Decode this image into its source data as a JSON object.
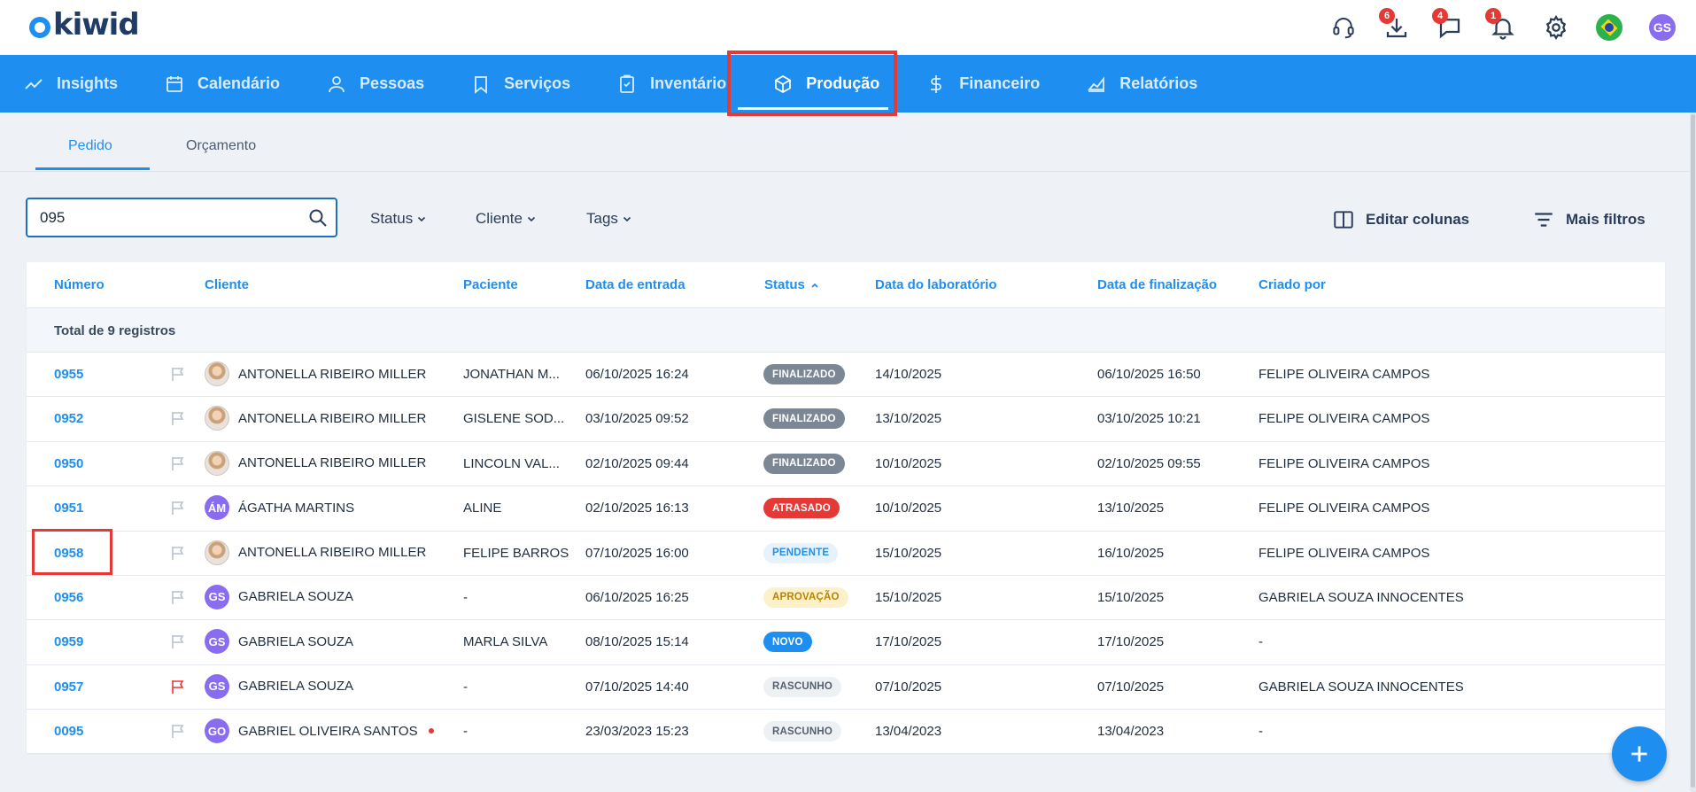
{
  "app": {
    "logo_text": "kiwid",
    "user_initials": "GS"
  },
  "topbar": {
    "download_badge": "6",
    "chat_badge": "4",
    "notifications_badge": "1"
  },
  "nav": {
    "items": [
      {
        "label": "Insights",
        "icon": "chart-line-icon"
      },
      {
        "label": "Calendário",
        "icon": "calendar-icon"
      },
      {
        "label": "Pessoas",
        "icon": "person-icon"
      },
      {
        "label": "Serviços",
        "icon": "bookmark-icon"
      },
      {
        "label": "Inventário",
        "icon": "clipboard-icon"
      },
      {
        "label": "Produção",
        "icon": "box-icon",
        "active": true
      },
      {
        "label": "Financeiro",
        "icon": "dollar-icon"
      },
      {
        "label": "Relatórios",
        "icon": "area-chart-icon"
      }
    ]
  },
  "subtabs": {
    "pedido": "Pedido",
    "orcamento": "Orçamento"
  },
  "filters": {
    "search_value": "095",
    "status": "Status",
    "cliente": "Cliente",
    "tags": "Tags",
    "edit_columns": "Editar colunas",
    "more_filters": "Mais filtros"
  },
  "table": {
    "headers": {
      "numero": "Número",
      "cliente": "Cliente",
      "paciente": "Paciente",
      "data_entrada": "Data de entrada",
      "status": "Status",
      "data_laboratorio": "Data do laboratório",
      "data_finalizacao": "Data de finalização",
      "criado_por": "Criado por"
    },
    "total_label": "Total de 9 registros",
    "rows": [
      {
        "numero": "0955",
        "flag": "grey",
        "avatar": "photo",
        "avatar_text": "",
        "cliente": "ANTONELLA RIBEIRO MILLER",
        "paciente": "JONATHAN M...",
        "data_entrada": "06/10/2025 16:24",
        "status": "FINALIZADO",
        "status_class": "s-finalizado",
        "data_laboratorio": "14/10/2025",
        "data_finalizacao": "06/10/2025 16:50",
        "criado_por": "FELIPE OLIVEIRA CAMPOS"
      },
      {
        "numero": "0952",
        "flag": "grey",
        "avatar": "photo",
        "avatar_text": "",
        "cliente": "ANTONELLA RIBEIRO MILLER",
        "paciente": "GISLENE SOD...",
        "data_entrada": "03/10/2025 09:52",
        "status": "FINALIZADO",
        "status_class": "s-finalizado",
        "data_laboratorio": "13/10/2025",
        "data_finalizacao": "03/10/2025 10:21",
        "criado_por": "FELIPE OLIVEIRA CAMPOS"
      },
      {
        "numero": "0950",
        "flag": "grey",
        "avatar": "photo",
        "avatar_text": "",
        "cliente": "ANTONELLA RIBEIRO MILLER",
        "paciente": "LINCOLN VAL...",
        "data_entrada": "02/10/2025 09:44",
        "status": "FINALIZADO",
        "status_class": "s-finalizado",
        "data_laboratorio": "10/10/2025",
        "data_finalizacao": "02/10/2025 09:55",
        "criado_por": "FELIPE OLIVEIRA CAMPOS"
      },
      {
        "numero": "0951",
        "flag": "grey",
        "avatar": "purple",
        "avatar_text": "ÁM",
        "cliente": "ÁGATHA MARTINS",
        "paciente": "ALINE",
        "data_entrada": "02/10/2025 16:13",
        "status": "ATRASADO",
        "status_class": "s-atrasado",
        "data_laboratorio": "10/10/2025",
        "data_finalizacao": "13/10/2025",
        "criado_por": "FELIPE OLIVEIRA CAMPOS"
      },
      {
        "numero": "0958",
        "flag": "grey",
        "avatar": "photo",
        "avatar_text": "",
        "cliente": "ANTONELLA RIBEIRO MILLER",
        "paciente": "FELIPE BARROS",
        "data_entrada": "07/10/2025 16:00",
        "status": "PENDENTE",
        "status_class": "s-pendente",
        "data_laboratorio": "15/10/2025",
        "data_finalizacao": "16/10/2025",
        "criado_por": "FELIPE OLIVEIRA CAMPOS"
      },
      {
        "numero": "0956",
        "flag": "grey",
        "avatar": "purple",
        "avatar_text": "GS",
        "cliente": "GABRIELA SOUZA",
        "paciente": "-",
        "data_entrada": "06/10/2025 16:25",
        "status": "APROVAÇÃO",
        "status_class": "s-aprovacao",
        "data_laboratorio": "15/10/2025",
        "data_finalizacao": "15/10/2025",
        "criado_por": "GABRIELA SOUZA INNOCENTES"
      },
      {
        "numero": "0959",
        "flag": "grey",
        "avatar": "purple",
        "avatar_text": "GS",
        "cliente": "GABRIELA SOUZA",
        "paciente": "MARLA SILVA",
        "data_entrada": "08/10/2025 15:14",
        "status": "NOVO",
        "status_class": "s-novo",
        "data_laboratorio": "17/10/2025",
        "data_finalizacao": "17/10/2025",
        "criado_por": "-"
      },
      {
        "numero": "0957",
        "flag": "red",
        "avatar": "purple",
        "avatar_text": "GS",
        "cliente": "GABRIELA SOUZA",
        "paciente": "-",
        "data_entrada": "07/10/2025 14:40",
        "status": "RASCUNHO",
        "status_class": "s-rascunho",
        "data_laboratorio": "07/10/2025",
        "data_finalizacao": "07/10/2025",
        "criado_por": "GABRIELA SOUZA INNOCENTES"
      },
      {
        "numero": "0095",
        "flag": "grey",
        "avatar": "purple",
        "avatar_text": "GO",
        "cliente": "GABRIEL OLIVEIRA SANTOS",
        "red_dot": true,
        "paciente": "-",
        "data_entrada": "23/03/2023 15:23",
        "status": "RASCUNHO",
        "status_class": "s-rascunho",
        "data_laboratorio": "13/04/2023",
        "data_finalizacao": "13/04/2023",
        "criado_por": "-"
      }
    ]
  },
  "colors": {
    "primary": "#1e8ff0",
    "highlight": "#e53935"
  }
}
